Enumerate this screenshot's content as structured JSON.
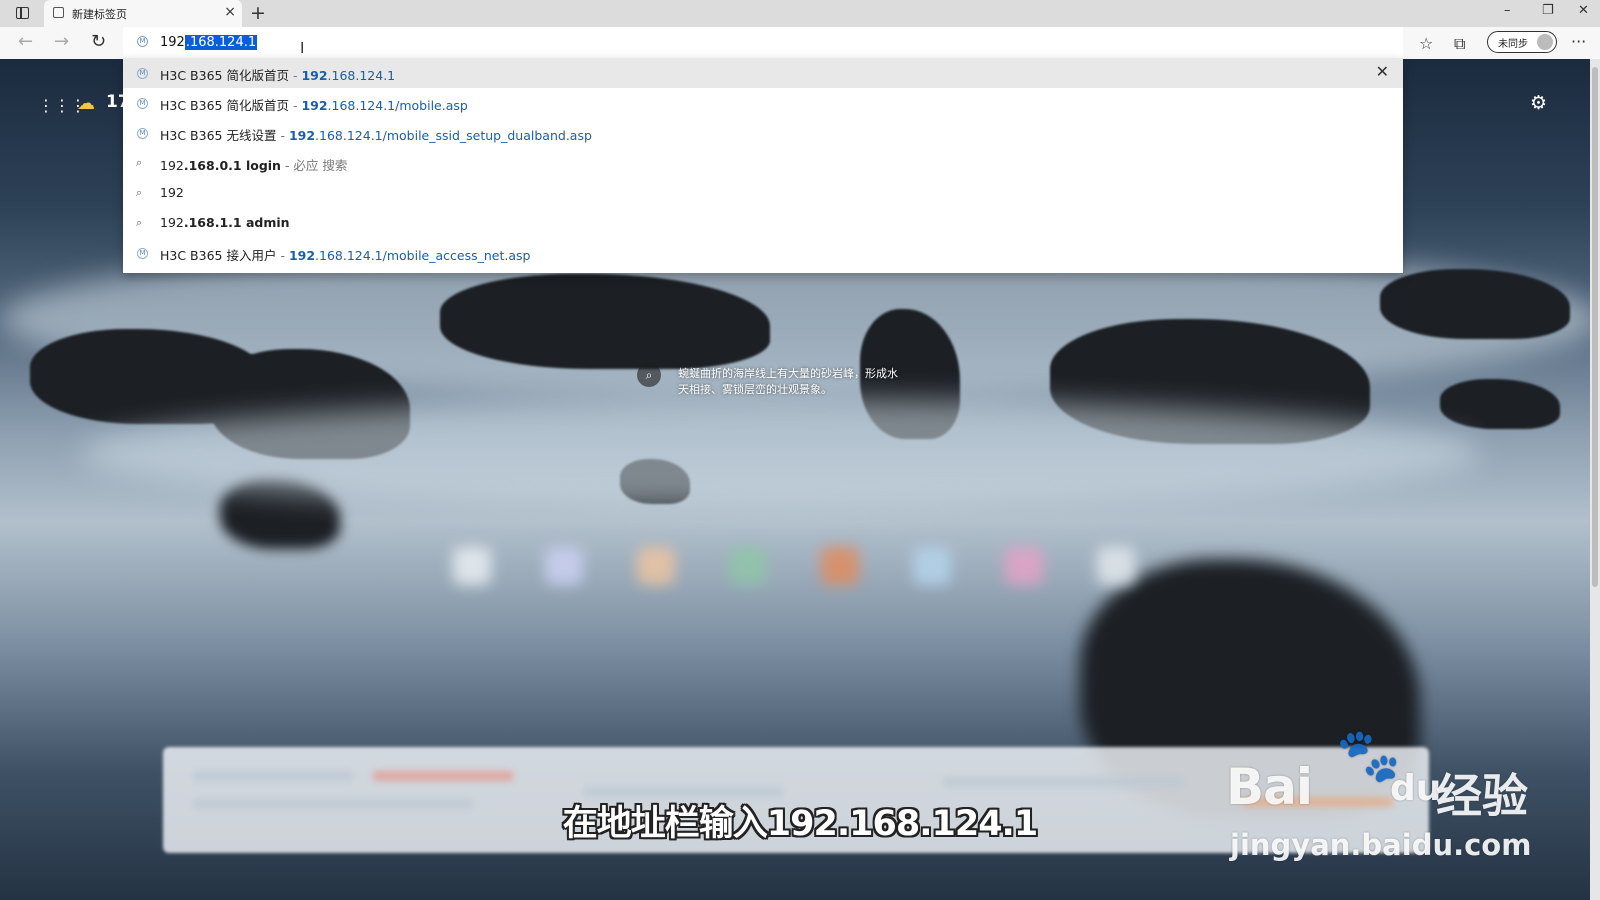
{
  "tab": {
    "title": "新建标签页",
    "close_glyph": "×"
  },
  "new_tab_glyph": "+",
  "window_controls": {
    "minimize": "–",
    "restore": "❐",
    "close": "✕"
  },
  "toolbar": {
    "back_glyph": "←",
    "forward_glyph": "→",
    "reload_glyph": "↻",
    "favorites_glyph": "☆",
    "collections_glyph": "⧉",
    "sync_label": "未同步",
    "menu_glyph": "···"
  },
  "address": {
    "typed": "192",
    "autocomplete": ".168.124.1"
  },
  "suggestions": [
    {
      "kind": "history",
      "title": "H3C B365 简化版首页",
      "sep": " - ",
      "url_bold": "192",
      "url_rest": ".168.124.1",
      "selected": true
    },
    {
      "kind": "history",
      "title": "H3C B365 简化版首页",
      "sep": " - ",
      "url_bold": "192",
      "url_rest": ".168.124.1/mobile.asp"
    },
    {
      "kind": "history",
      "title": "H3C B365 无线设置",
      "sep": " - ",
      "url_bold": "192",
      "url_rest": ".168.124.1/mobile_ssid_setup_dualband.asp"
    },
    {
      "kind": "search",
      "plain": "192",
      "bold": ".168.0.1 login",
      "sub": " - 必应 搜索"
    },
    {
      "kind": "search",
      "plain": "192",
      "bold": "",
      "sub": ""
    },
    {
      "kind": "search",
      "plain": "192",
      "bold": ".168.1.1 admin",
      "sub": ""
    },
    {
      "kind": "history",
      "title": "H3C B365 接入用户",
      "sep": " - ",
      "url_bold": "192",
      "url_rest": ".168.124.1/mobile_access_net.asp"
    }
  ],
  "newtab": {
    "temperature": "17",
    "image_caption": "蜿蜒曲折的海岸线上有大量的砂岩峰，形成水天相接、雾锁层峦的壮观景象。"
  },
  "video_subtitle": "在地址栏输入192.168.124.1",
  "watermark": {
    "brand_left": "Bai",
    "brand_right": "du",
    "paw": "🐾",
    "product": "经验",
    "url": "jingyan.baidu.com"
  },
  "icons": {
    "tab": "page-icon",
    "sidebar": "sidebar-icon",
    "history": "history-m-icon",
    "search": "magnifier-icon",
    "apps": "apps-grid-icon",
    "weather": "partly-cloudy-icon",
    "settings": "gear-icon",
    "lens": "lens-icon"
  },
  "colors": {
    "selection": "#0a5fd8",
    "url_link": "#1a5fa8",
    "selected_row": "#e8e8e8"
  }
}
